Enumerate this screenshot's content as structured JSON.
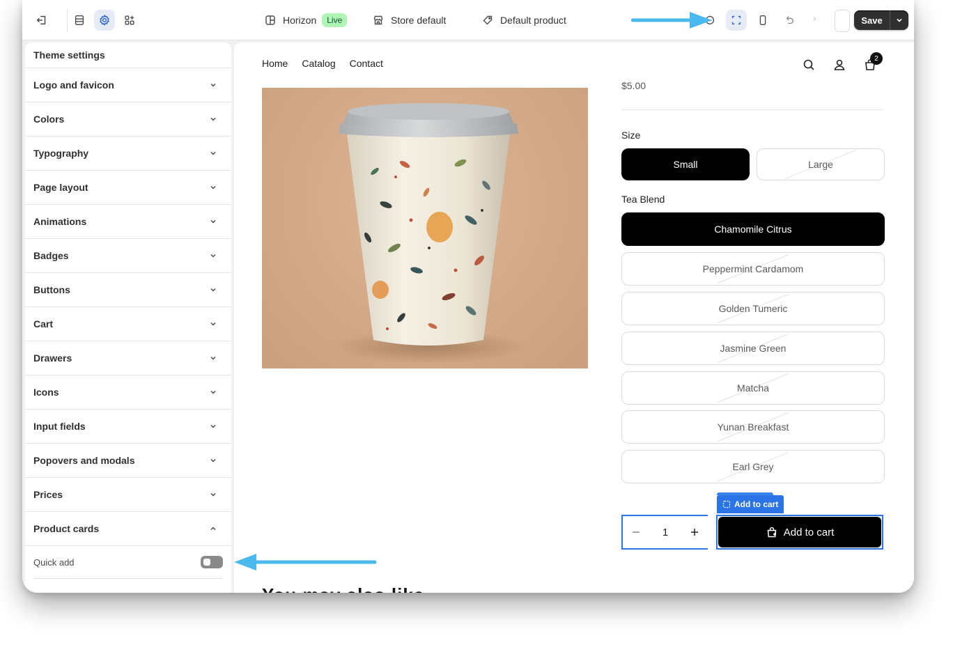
{
  "topbar": {
    "theme_name": "Horizon",
    "theme_status": "Live",
    "store_label": "Store default",
    "product_label": "Default product",
    "save_label": "Save"
  },
  "sidebar": {
    "title": "Theme settings",
    "items": [
      {
        "label": "Logo and favicon"
      },
      {
        "label": "Colors"
      },
      {
        "label": "Typography"
      },
      {
        "label": "Page layout"
      },
      {
        "label": "Animations"
      },
      {
        "label": "Badges"
      },
      {
        "label": "Buttons"
      },
      {
        "label": "Cart"
      },
      {
        "label": "Drawers"
      },
      {
        "label": "Icons"
      },
      {
        "label": "Input fields"
      },
      {
        "label": "Popovers and modals"
      },
      {
        "label": "Prices"
      }
    ],
    "expanded_item": {
      "label": "Product cards",
      "setting_label": "Quick add",
      "setting_enabled": false
    }
  },
  "preview": {
    "nav": [
      "Home",
      "Catalog",
      "Contact"
    ],
    "cart_count": "2",
    "price_partial": "$5.00",
    "size_label": "Size",
    "sizes": [
      {
        "label": "Small",
        "selected": true
      },
      {
        "label": "Large",
        "selected": false
      }
    ],
    "blend_label": "Tea Blend",
    "blends": [
      {
        "label": "Chamomile Citrus",
        "selected": true
      },
      {
        "label": "Peppermint Cardamom",
        "selected": false
      },
      {
        "label": "Golden Tumeric",
        "selected": false
      },
      {
        "label": "Jasmine Green",
        "selected": false
      },
      {
        "label": "Matcha",
        "selected": false
      },
      {
        "label": "Yunan Breakfast",
        "selected": false
      },
      {
        "label": "Earl Grey",
        "selected": false
      }
    ],
    "block_tag": "Add to cart",
    "quantity": "1",
    "add_to_cart_label": "Add to cart",
    "heading_partial": "You may also like"
  },
  "colors": {
    "accent_blue": "#2a74e6",
    "annotation_arrow": "#4bb8ee",
    "live_badge": "#aff5b4"
  }
}
